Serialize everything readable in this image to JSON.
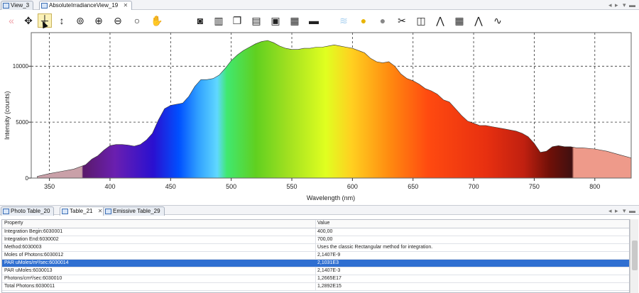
{
  "top_tabs": [
    {
      "label": "View_3",
      "active": false
    },
    {
      "label": "AbsoluteIrradianceView_19",
      "active": true
    }
  ],
  "toolbar": {
    "icons": [
      "double-arrow-left-icon",
      "move-icon",
      "crosshair-icon",
      "vertical-arrow-icon",
      "zoom-area-icon",
      "zoom-in-icon",
      "zoom-out-icon",
      "zoom-fit-icon",
      "pan-hand-icon",
      "blank-icon",
      "camera-icon",
      "trash-icon",
      "copy-icon",
      "save-icon",
      "save-as-icon",
      "export-icon",
      "print-icon",
      "wave-icon",
      "bulb-on-icon",
      "bulb-off-icon",
      "tools-icon",
      "graph-icon",
      "peak-icon",
      "table-icon",
      "spectrum-icon",
      "signature-icon"
    ]
  },
  "chart_data": {
    "type": "area",
    "xlabel": "Wavelength (nm)",
    "ylabel": "Intensity (counts)",
    "xlim": [
      335,
      830
    ],
    "ylim": [
      0,
      13000
    ],
    "x_ticks": [
      350,
      400,
      450,
      500,
      550,
      600,
      650,
      700,
      750,
      800
    ],
    "y_ticks": [
      0,
      5000,
      10000
    ],
    "grid": true,
    "x": [
      340,
      350,
      360,
      370,
      380,
      385,
      390,
      395,
      400,
      405,
      410,
      415,
      420,
      425,
      430,
      435,
      440,
      445,
      450,
      455,
      460,
      465,
      470,
      475,
      480,
      485,
      490,
      495,
      500,
      505,
      510,
      515,
      520,
      525,
      530,
      535,
      540,
      545,
      550,
      555,
      560,
      565,
      570,
      575,
      580,
      585,
      590,
      595,
      600,
      605,
      610,
      615,
      620,
      625,
      630,
      635,
      640,
      645,
      650,
      655,
      660,
      665,
      670,
      675,
      680,
      685,
      690,
      695,
      700,
      705,
      710,
      715,
      720,
      725,
      730,
      735,
      740,
      745,
      750,
      755,
      760,
      765,
      770,
      775,
      780,
      785,
      790,
      800,
      810,
      820,
      830
    ],
    "y": [
      150,
      400,
      600,
      800,
      1200,
      1700,
      2000,
      2500,
      2900,
      3000,
      3000,
      2950,
      2850,
      3000,
      3400,
      4000,
      5200,
      6200,
      6500,
      6600,
      6700,
      7300,
      8200,
      8800,
      8800,
      8900,
      9200,
      9800,
      10500,
      11000,
      11400,
      11700,
      12000,
      12200,
      12300,
      12100,
      11800,
      11600,
      11500,
      11500,
      11600,
      11600,
      11700,
      11700,
      11800,
      11900,
      11800,
      11700,
      11600,
      11400,
      11200,
      10700,
      10400,
      10300,
      10400,
      10000,
      9300,
      8900,
      8700,
      8400,
      8000,
      7800,
      7500,
      7000,
      6800,
      6200,
      5600,
      5100,
      4900,
      4700,
      4700,
      4600,
      4500,
      4400,
      4300,
      4200,
      4000,
      3700,
      3100,
      2300,
      2400,
      2800,
      2900,
      2800,
      2800,
      2700,
      2700,
      2600,
      2400,
      2100,
      1800
    ]
  },
  "bottom_tabs": [
    {
      "label": "Photo Table_20",
      "active": false
    },
    {
      "label": "Table_21",
      "active": true
    },
    {
      "label": "Emissive Table_29",
      "active": false
    }
  ],
  "table": {
    "headers": [
      "Property",
      "Value"
    ],
    "rows": [
      {
        "property": "Integration Begin:6030001",
        "value": "400,00",
        "selected": false
      },
      {
        "property": "Integration End:6030002",
        "value": "700,00",
        "selected": false
      },
      {
        "property": "Method:6030003",
        "value": "Uses the classic Rectangular method for integration.",
        "selected": false
      },
      {
        "property": "Moles of Photons:6030012",
        "value": "2,1407E-9",
        "selected": false
      },
      {
        "property": "PAR uMoles/m²/sec:6030014",
        "value": "2,1031E3",
        "selected": true
      },
      {
        "property": "PAR uMoles:6030013",
        "value": "2,1407E-3",
        "selected": false
      },
      {
        "property": "Photons/cm²/sec:6030010",
        "value": "1,2665E17",
        "selected": false
      },
      {
        "property": "Total Photons:6030011",
        "value": "1,2892E15",
        "selected": false
      }
    ]
  }
}
